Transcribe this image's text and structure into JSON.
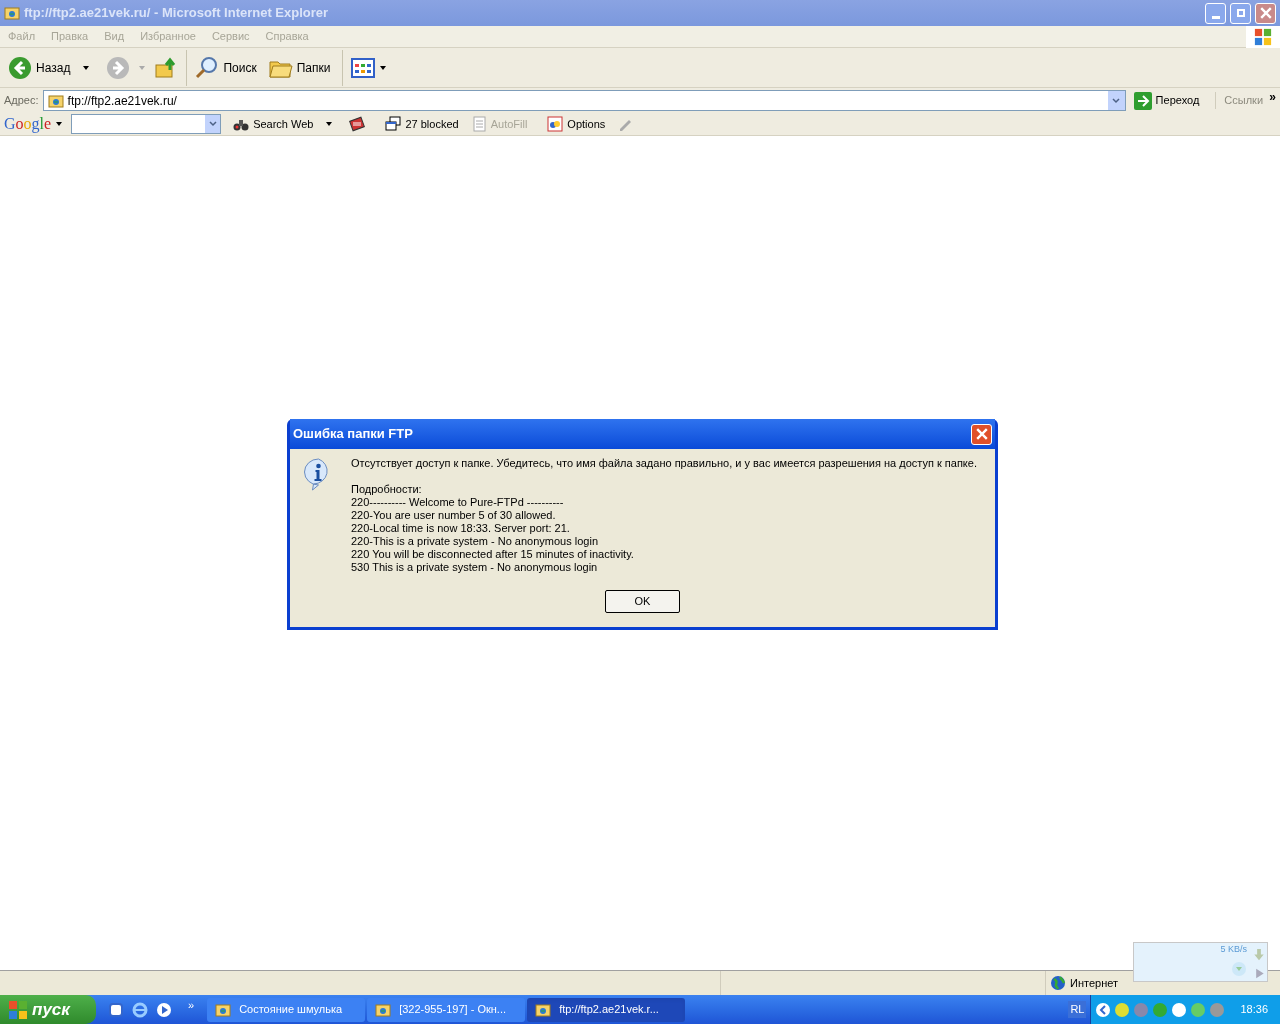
{
  "window": {
    "title": "ftp://ftp2.ae21vek.ru/ - Microsoft Internet Explorer"
  },
  "menu": [
    "Файл",
    "Правка",
    "Вид",
    "Избранное",
    "Сервис",
    "Справка"
  ],
  "toolbar": [
    {
      "kind": "back",
      "label": "Назад"
    },
    {
      "kind": "forward"
    },
    {
      "kind": "up"
    },
    {
      "kind": "search",
      "label": "Поиск"
    },
    {
      "kind": "folders",
      "label": "Папки"
    },
    {
      "kind": "views"
    }
  ],
  "address": {
    "label": "Адрес:",
    "value": "ftp://ftp2.ae21vek.ru/",
    "go": "Переход",
    "links": "Ссылки",
    "more": "»"
  },
  "google_bar": {
    "logo": "Google",
    "search_button": "Search Web",
    "blocked": "27 blocked",
    "autofill": {
      "label": "AutoFill",
      "disabled": true
    },
    "options": "Options"
  },
  "dialog": {
    "title": "Ошибка папки FTP",
    "message": "Отсутствует доступ к папке. Убедитесь, что имя файла задано правильно, и у вас имеется разрешения на доступ к папке.",
    "details": [
      "Подробности:",
      "220---------- Welcome to Pure-FTPd ----------",
      "220-You are user number 5 of 30 allowed.",
      "220-Local time is now 18:33. Server port: 21.",
      "220-This is a private system - No anonymous login",
      "220 You will be disconnected after 15 minutes of inactivity.",
      "530 This is a private system - No anonymous login"
    ],
    "button": "OK"
  },
  "status_bar": {
    "zone": "Интернет"
  },
  "speed_widget": {
    "reading": "5 KB/s"
  },
  "taskbar": {
    "start": "пуск",
    "more": "»",
    "tasks": [
      {
        "label": "Состояние шмулька",
        "selected": false
      },
      {
        "label": "[322-955-197] - Окн...",
        "selected": false
      },
      {
        "label": "ftp://ftp2.ae21vek.r...",
        "selected": true
      }
    ],
    "language": "RL",
    "clock": "18:36"
  }
}
